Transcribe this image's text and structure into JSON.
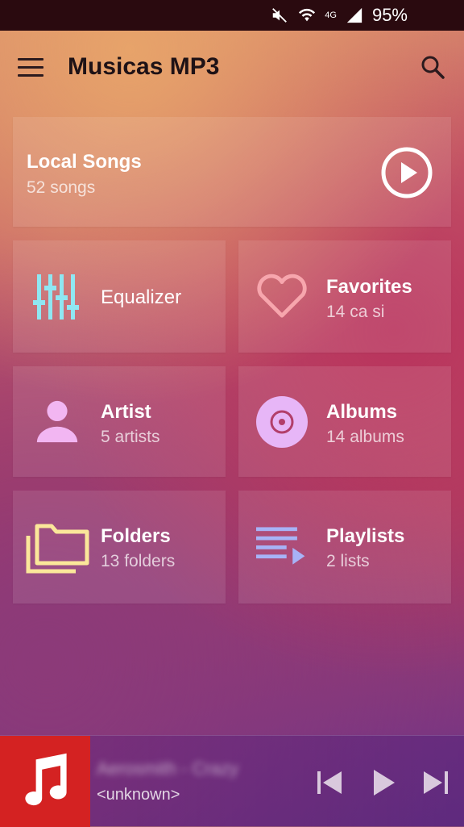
{
  "status_bar": {
    "network": "4G",
    "battery": "95%"
  },
  "app_bar": {
    "title": "Musicas MP3"
  },
  "local_songs": {
    "title": "Local Songs",
    "subtitle": "52 songs"
  },
  "tiles": [
    {
      "title": "Equalizer",
      "subtitle": "",
      "icon": "equalizer-icon",
      "icon_color": "#8fe7f2"
    },
    {
      "title": "Favorites",
      "subtitle": "14 ca si",
      "icon": "heart-icon",
      "icon_color": "#f7a6ad"
    },
    {
      "title": "Artist",
      "subtitle": "5 artists",
      "icon": "person-icon",
      "icon_color": "#f2b6f2"
    },
    {
      "title": "Albums",
      "subtitle": "14 albums",
      "icon": "disc-icon",
      "icon_color": "#e7b6f7"
    },
    {
      "title": "Folders",
      "subtitle": "13 folders",
      "icon": "folder-icon",
      "icon_color": "#fbe79a"
    },
    {
      "title": "Playlists",
      "subtitle": "2 lists",
      "icon": "playlist-icon",
      "icon_color": "#a7b3f7"
    }
  ],
  "mini_player": {
    "track_title": "Aerosmith - Crazy",
    "track_artist": "<unknown>"
  },
  "colors": {
    "status_bar_bg": "#2a0a0f",
    "album_art_bg": "#d42222"
  }
}
